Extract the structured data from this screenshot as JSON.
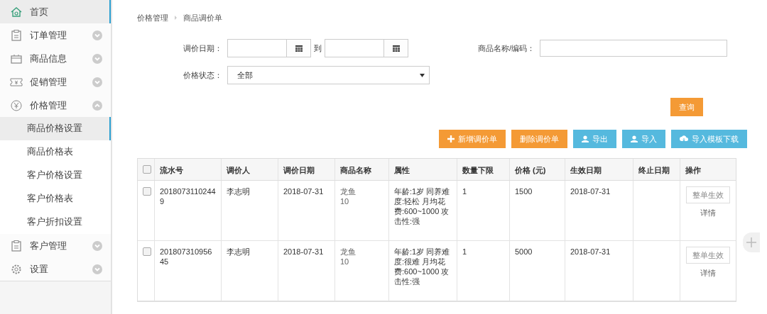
{
  "sidebar": {
    "items": [
      {
        "label": "首页",
        "selected": true
      },
      {
        "label": "订单管理",
        "selected": false,
        "expanded": false
      },
      {
        "label": "商品信息",
        "selected": false,
        "expanded": false
      },
      {
        "label": "促销管理",
        "selected": false,
        "expanded": false
      },
      {
        "label": "价格管理",
        "selected": false,
        "expanded": true,
        "children": [
          {
            "label": "商品价格设置",
            "selected": true
          },
          {
            "label": "商品价格表",
            "selected": false
          },
          {
            "label": "客户价格设置",
            "selected": false
          },
          {
            "label": "客户价格表",
            "selected": false
          },
          {
            "label": "客户折扣设置",
            "selected": false
          }
        ]
      },
      {
        "label": "客户管理",
        "selected": false,
        "expanded": false
      },
      {
        "label": "设置",
        "selected": false,
        "expanded": false
      }
    ]
  },
  "breadcrumb": [
    "价格管理",
    "商品调价单"
  ],
  "filters": {
    "date_label": "调价日期：",
    "date_to": "到",
    "name_label": "商品名称/编码：",
    "status_label": "价格状态：",
    "status_value": "全部",
    "query_button": "查询"
  },
  "toolbar": [
    "新增调价单",
    "删除调价单",
    "导出",
    "导入",
    "导入模板下载"
  ],
  "table": {
    "all_checked": false,
    "columns": [
      "流水号",
      "调价人",
      "调价日期",
      "商品名称",
      "属性",
      "数量下限",
      "价格 (元)",
      "生效日期",
      "终止日期",
      "操作"
    ],
    "rows": [
      {
        "checked": false,
        "cells": [
          "20180731102449",
          "李志明",
          "2018-07-31",
          "龙鱼\n10",
          "年龄:1岁 同养难度:轻松 月均花费:600~1000 攻击性:强",
          "1",
          "1500",
          "2018-07-31",
          ""
        ],
        "action_button": "整单生效",
        "action_link": "详情"
      },
      {
        "checked": false,
        "cells": [
          "20180731095645",
          "李志明",
          "2018-07-31",
          "龙鱼\n10",
          "年龄:1岁 同养难度:很难 月均花费:600~1000 攻击性:强",
          "1",
          "5000",
          "2018-07-31",
          ""
        ],
        "action_button": "整单生效",
        "action_link": "详情"
      }
    ]
  }
}
